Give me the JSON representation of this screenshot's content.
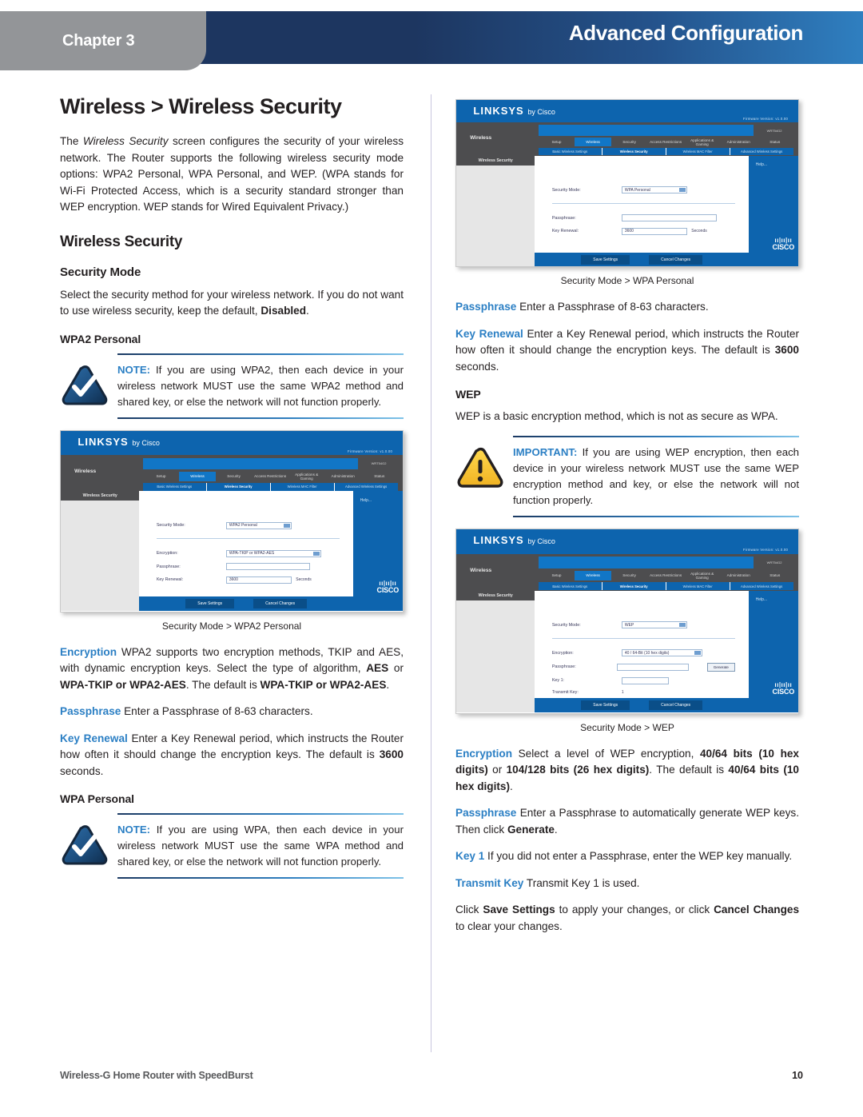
{
  "header": {
    "chapter": "Chapter 3",
    "title": "Advanced Configuration"
  },
  "left_column": {
    "page_title": "Wireless > Wireless Security",
    "intro_p1_a": "The ",
    "intro_p1_em": "Wireless Security",
    "intro_p1_b": " screen configures the security of your wireless network. The Router supports the following wireless security mode options: WPA2 Personal, WPA Personal, and WEP. (WPA stands for Wi-Fi Protected Access, which is a security standard stronger than WEP encryption. WEP stands for Wired Equivalent Privacy.)",
    "section_title": "Wireless Security",
    "security_mode_heading": "Security Mode",
    "security_mode_body_a": "Select the security method for your wireless network. If you do not want to use wireless security, keep the default, ",
    "security_mode_body_bold": "Disabled",
    "security_mode_body_b": ".",
    "wpa2_heading": "WPA2 Personal",
    "note_wpa2_label": "NOTE:",
    "note_wpa2_text": " If you are using WPA2, then each device in your wireless network MUST use the same WPA2 method and shared key, or else the network will not function properly.",
    "shot_wpa2_caption": "Security Mode > WPA2 Personal",
    "encryption_term": "Encryption",
    "encryption_a": " WPA2 supports two encryption methods, TKIP and AES, with dynamic encryption keys. Select the type of algorithm, ",
    "encryption_b1": "AES",
    "encryption_c": " or ",
    "encryption_b2": "WPA-TKIP or WPA2-AES",
    "encryption_d": ". The default is ",
    "encryption_b3": "WPA-TKIP or WPA2-AES",
    "encryption_e": ".",
    "passphrase_term": "Passphrase",
    "passphrase_text": "  Enter a Passphrase of 8-63 characters.",
    "keyrenewal_term": "Key Renewal",
    "keyrenewal_a": "  Enter a Key Renewal period, which instructs the Router how often it should change the encryption keys. The default is ",
    "keyrenewal_bold": "3600",
    "keyrenewal_b": " seconds.",
    "wpa_heading": "WPA Personal",
    "note_wpa_label": "NOTE:",
    "note_wpa_text": " If you are using WPA, then each device in your wireless network MUST use the same WPA method and shared key, or else the network will not function properly."
  },
  "right_column": {
    "shot_wpa_caption": "Security Mode > WPA Personal",
    "passphrase_term": "Passphrase",
    "passphrase_text": "  Enter a Passphrase of 8-63 characters.",
    "keyrenewal_term": "Key Renewal",
    "keyrenewal_a": "  Enter a Key Renewal period, which instructs the Router how often it should change the encryption keys. The default is ",
    "keyrenewal_bold": "3600",
    "keyrenewal_b": " seconds.",
    "wep_heading": "WEP",
    "wep_body": "WEP is a basic encryption method, which is not as secure as WPA.",
    "important_label": "IMPORTANT:",
    "important_text": " If you are using WEP encryption, then each device in your wireless network MUST use the same WEP encryption method and key, or else the network will not function properly.",
    "shot_wep_caption": "Security Mode > WEP",
    "encryption_term": "Encryption",
    "encryption_a": " Select a level of WEP encryption, ",
    "encryption_b1": "40/64 bits (10 hex digits)",
    "encryption_c": " or ",
    "encryption_b2": "104/128 bits (26 hex digits)",
    "encryption_d": ". The default is ",
    "encryption_b3": "40/64 bits (10 hex digits)",
    "encryption_e": ".",
    "wep_passphrase_term": "Passphrase",
    "wep_passphrase_a": "  Enter a Passphrase to automatically generate WEP keys. Then click ",
    "wep_passphrase_bold": "Generate",
    "wep_passphrase_b": ".",
    "key1_term": "Key 1",
    "key1_text": "  If you did not enter a Passphrase, enter the WEP key manually.",
    "transmitkey_term": "Transmit Key",
    "transmitkey_text": "  Transmit Key 1 is used.",
    "save_a": "Click ",
    "save_b1": "Save Settings",
    "save_c": " to apply your changes, or click ",
    "save_b2": "Cancel Changes",
    "save_d": " to clear your changes."
  },
  "router_ui": {
    "brand": "LINKSYS",
    "brand_suffix": "by Cisco",
    "firmware": "Firmware Version: v1.0.00",
    "section_name": "Wireless",
    "router_model": "WRT54G2",
    "tabs": [
      "Setup",
      "Wireless",
      "Security",
      "Access Restrictions",
      "Applications & Gaming",
      "Administration",
      "Status"
    ],
    "active_tab": "Wireless",
    "subtabs": [
      "Basic Wireless Settings",
      "Wireless Security",
      "Wireless MAC Filter",
      "Advanced Wireless Settings"
    ],
    "active_subtab": "Wireless Security",
    "side_header": "Wireless Security",
    "help_label": "Help...",
    "cisco_label": "CISCO",
    "save_button": "Save Settings",
    "cancel_button": "Cancel Changes",
    "labels": {
      "security_mode": "Security Mode:",
      "encryption": "Encryption:",
      "passphrase": "Passphrase:",
      "key_renewal": "Key Renewal:",
      "key1": "Key 1:",
      "transmit_key": "Transmit Key:",
      "seconds": "Seconds",
      "generate": "Generate"
    },
    "wpa2_form": {
      "security_mode_value": "WPA2 Personal",
      "encryption_value": "WPA-TKIP or WPA2-AES",
      "passphrase_value": "",
      "key_renewal_value": "3600"
    },
    "wpa_form": {
      "security_mode_value": "WPA Personal",
      "passphrase_value": "",
      "key_renewal_value": "3600"
    },
    "wep_form": {
      "security_mode_value": "WEP",
      "encryption_value": "40 / 64-Bit (10 hex digits)",
      "passphrase_value": "",
      "key1_value": "",
      "transmit_key_value": "1"
    }
  },
  "footer": {
    "document_title": "Wireless-G Home Router with SpeedBurst",
    "page_number": "10"
  }
}
